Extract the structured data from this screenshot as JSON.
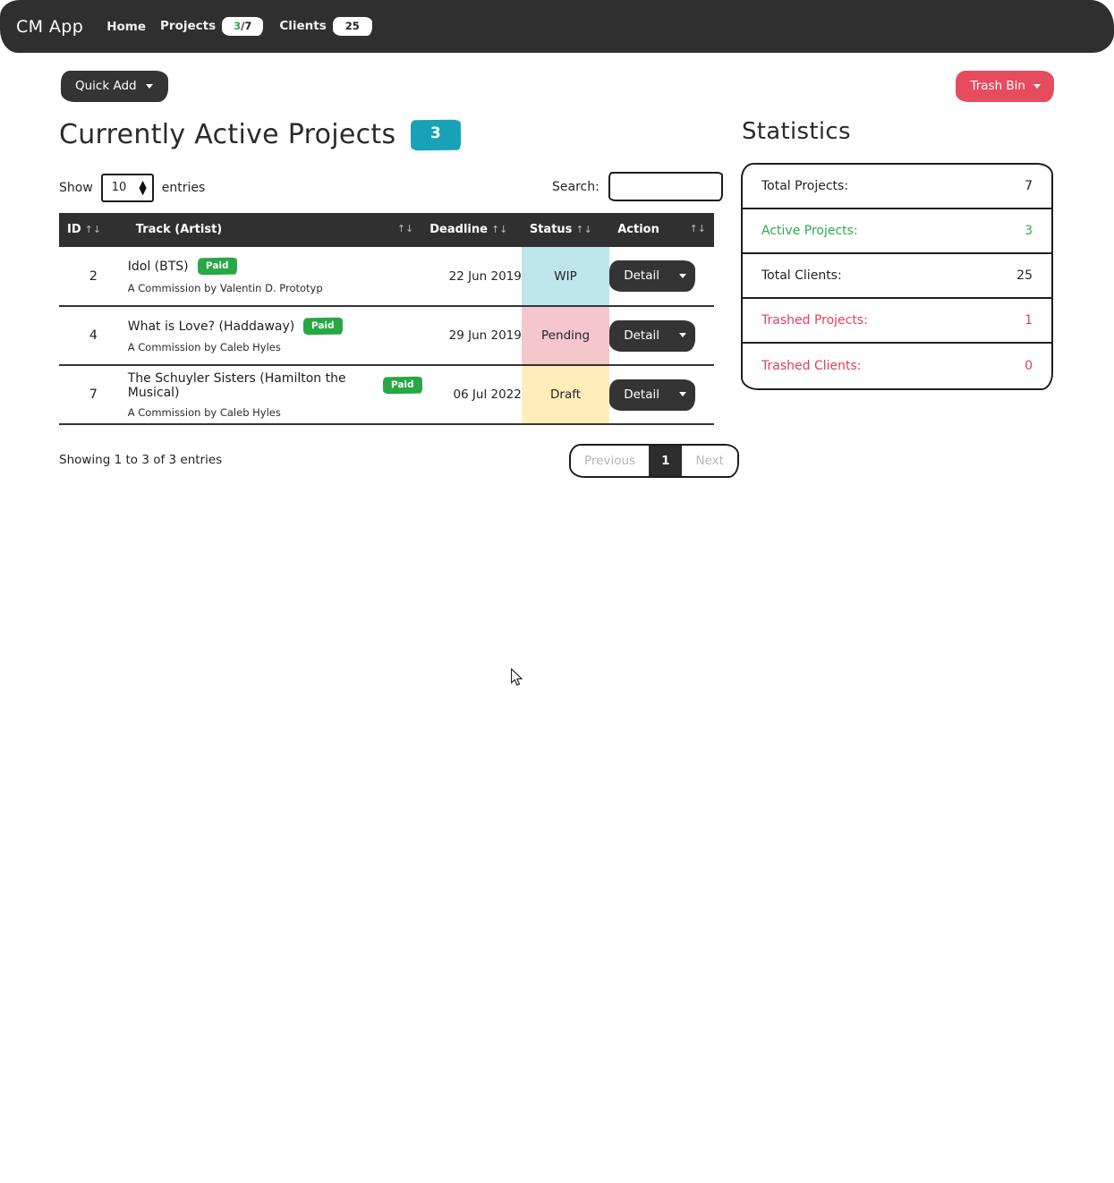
{
  "navbar": {
    "brand": "CM App",
    "items": [
      {
        "label": "Home",
        "badge": null
      },
      {
        "label": "Projects",
        "badge_active": "3",
        "badge_sep": "/7"
      },
      {
        "label": "Clients",
        "badge": "25"
      }
    ],
    "home_label": "Home",
    "projects_label": "Projects",
    "projects_badge_active": "3",
    "projects_badge_rest": "/7",
    "clients_label": "Clients",
    "clients_badge": "25"
  },
  "toolbar": {
    "quick_add_label": "Quick Add",
    "trash_bin_label": "Trash Bin"
  },
  "main": {
    "page_title": "Currently Active Projects",
    "page_title_count": "3",
    "length_label_before": "Show",
    "length_value": "10",
    "length_label_after": "entries",
    "search_label": "Search:",
    "search_value": "",
    "search_placeholder": "",
    "info_text": "Showing 1 to 3 of 3 entries",
    "pagination": {
      "previous_label": "Previous",
      "current_page": "1",
      "next_label": "Next"
    },
    "table": {
      "columns": [
        {
          "label": "ID",
          "sort_icon": "↑↓"
        },
        {
          "label": "Track (Artist)",
          "sort_icon": "↑↓"
        },
        {
          "label": "Deadline",
          "sort_icon": "↑↓"
        },
        {
          "label": "Status",
          "sort_icon": "↑↓"
        },
        {
          "label": "Action",
          "sort_icon": "↑↓"
        }
      ],
      "rows": [
        {
          "id": "2",
          "track": "Idol (BTS)",
          "paid_badge": "Paid",
          "commission": "A Commission by Valentin D. Prototyp",
          "deadline": "22 Jun 2019",
          "status": "WIP",
          "status_class": "st-wip",
          "action_label": "Detail"
        },
        {
          "id": "4",
          "track": "What is Love? (Haddaway)",
          "paid_badge": "Paid",
          "commission": "A Commission by Caleb Hyles",
          "deadline": "29 Jun 2019",
          "status": "Pending",
          "status_class": "st-pending",
          "action_label": "Detail"
        },
        {
          "id": "7",
          "track": "The Schuyler Sisters (Hamilton the Musical)",
          "paid_badge": "Paid",
          "commission": "A Commission by Caleb Hyles",
          "deadline": "06 Jul 2022",
          "status": "Draft",
          "status_class": "st-draft",
          "action_label": "Detail"
        }
      ]
    }
  },
  "statistics": {
    "title": "Statistics",
    "rows": [
      {
        "label": "Total Projects:",
        "value": "7",
        "tone": "neutral"
      },
      {
        "label": "Active Projects:",
        "value": "3",
        "tone": "success"
      },
      {
        "label": "Total Clients:",
        "value": "25",
        "tone": "neutral"
      },
      {
        "label": "Trashed Projects:",
        "value": "1",
        "tone": "danger"
      },
      {
        "label": "Trashed Clients:",
        "value": "0",
        "tone": "danger"
      }
    ]
  },
  "colors": {
    "navbar_bg": "#2f2f2f",
    "accent_info": "#17a2b8",
    "accent_success": "#28a745",
    "accent_danger": "#e74c5e",
    "status_wip": "#bee5eb",
    "status_pending": "#f5c6cb",
    "status_draft": "#ffeeba"
  }
}
